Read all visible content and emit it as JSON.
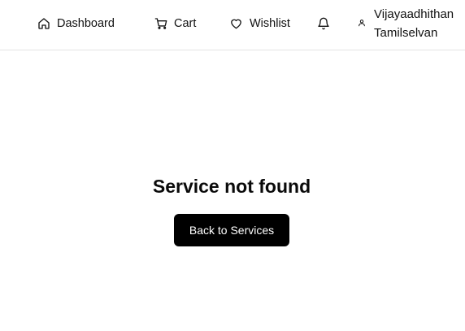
{
  "nav": {
    "dashboard": {
      "label": "Dashboard",
      "icon": "home-icon"
    },
    "cart": {
      "label": "Cart",
      "icon": "cart-icon"
    },
    "wishlist": {
      "label": "Wishlist",
      "icon": "heart-icon"
    },
    "notifications": {
      "icon": "bell-icon"
    },
    "user": {
      "icon": "user-icon",
      "first_line": "Vijayaadhithan",
      "second_line": "Tamilselvan"
    }
  },
  "main": {
    "title": "Service not found",
    "back_button_label": "Back to Services"
  },
  "colors": {
    "primary": "#000000",
    "text": "#111111",
    "border": "#e5e5e5",
    "background": "#ffffff"
  }
}
